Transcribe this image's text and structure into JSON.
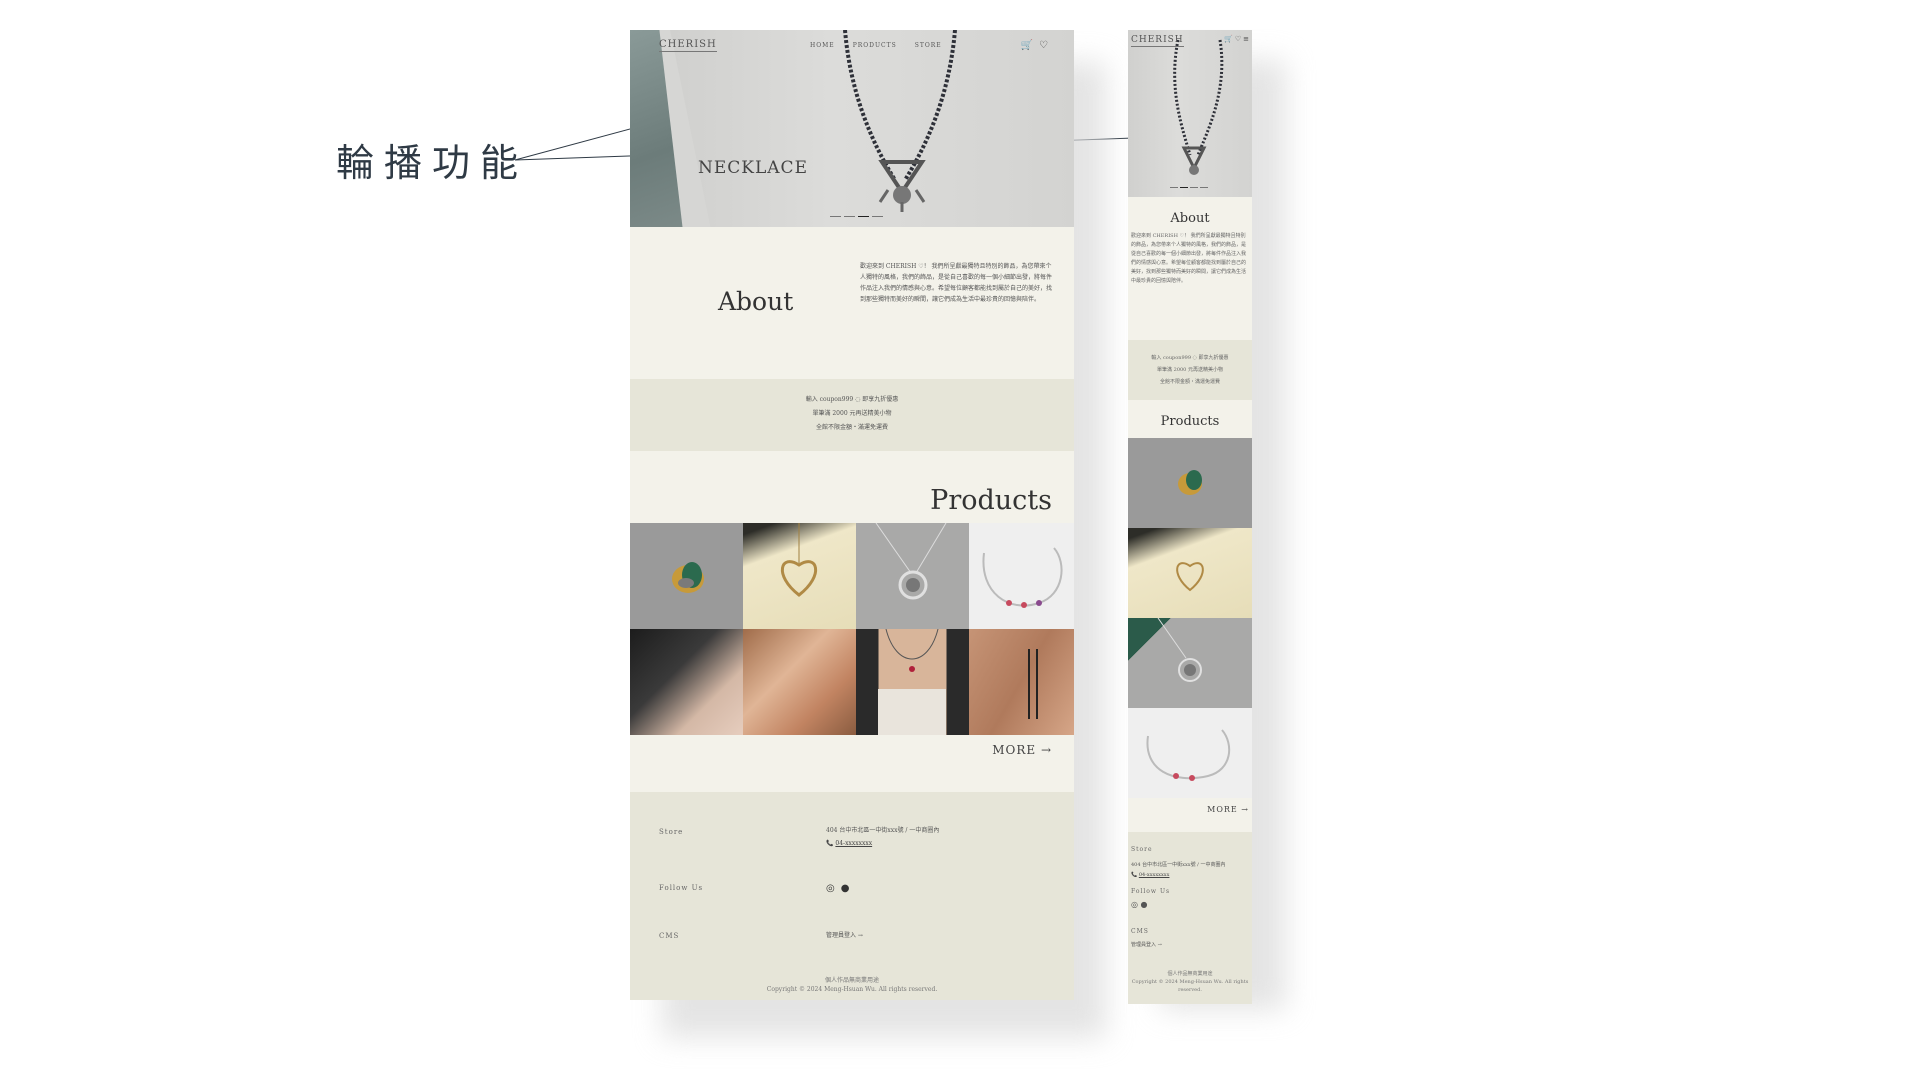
{
  "annotation": {
    "label": "輪播功能"
  },
  "site": {
    "logo": "CHERISH",
    "nav": [
      "HOME",
      "PRODUCTS",
      "STORE"
    ],
    "icons": [
      "cart-icon",
      "heart-icon"
    ],
    "hero_title": "NECKLACE",
    "about_title": "About",
    "about_text": "歡迎來到 CHERISH ♡！ 我們所呈獻最獨特且特別的飾品，為您帶來个人獨特的風格，我們的飾品，是從自己喜歡的每一個小細節出發，將每件作品注入我們的情感與心意。希望每位顧客都能找到屬於自己的美好，找到那些獨特而美好的瞬間，讓它們成為生活中最珍貴的回憶與陪伴。",
    "promo": [
      "輸入 coupon999 ◌ 即享九折優惠",
      "單筆滿 2000 元再送精美小物",
      "全館不限金額・滿運免運費"
    ],
    "products_title": "Products",
    "more": "MORE →",
    "footer": {
      "store_label": "Store",
      "store_address": "404 台中市北區一中街xxx號 / 一中商圈內",
      "phone": "04-xxxxxxxx",
      "follow_label": "Follow Us",
      "cms_label": "CMS",
      "cms_link": "管理員登入 →",
      "copy_line1": "個人作品無商業用途",
      "copy_line2": "Copyright © 2024 Meng-Hsuan Wu. All rights reserved."
    }
  },
  "mobile": {
    "about_text": "歡迎來到 CHERISH ♡！ 我們所呈獻最獨特且特別的飾品，為您帶來个人獨特的風格，我們的飾品，是從自己喜歡的每一個小細節出發，將每件作品注入我們的情感與心意。希望每位顧客都能找到屬於自己的美好，找到那些獨特而美好的瞬間，讓它們成為生活中最珍貴的回憶與陪伴。",
    "copy_line1": "個人作品無商業用途",
    "copy_line2": "Copyright © 2024 Meng-Hsuan Wu. All rights reserved."
  },
  "colors": {
    "bg_light": "#f3f2ea",
    "bg_beige": "#e6e5d8",
    "text": "#3a3a3a"
  }
}
